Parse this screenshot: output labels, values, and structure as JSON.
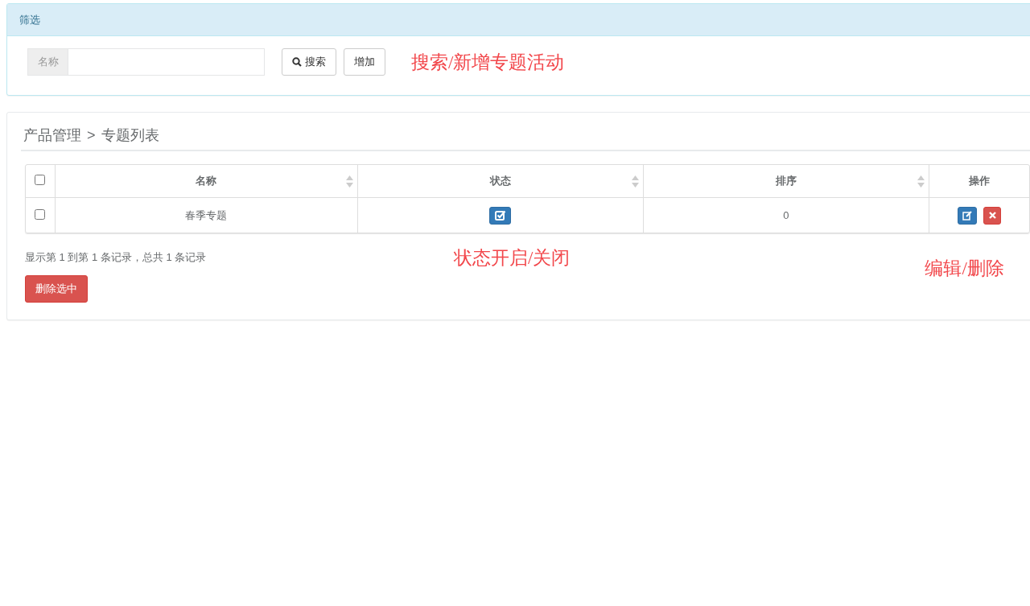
{
  "filter_panel": {
    "title": "筛选",
    "name_field": {
      "label": "名称"
    },
    "buttons": [
      {
        "kind": "search",
        "label": "搜索"
      },
      {
        "kind": "plain",
        "label": "增加"
      }
    ],
    "annotation": "搜索/新增专题活动"
  },
  "list_panel": {
    "breadcrumb": [
      "产品管理",
      ">",
      "专题列表"
    ],
    "table": {
      "select_all": {
        "checked": false
      },
      "columns": [
        {
          "label": "名称",
          "sortable": true
        },
        {
          "label": "状态",
          "sortable": true
        },
        {
          "label": "排序",
          "sortable": true
        },
        {
          "label": "操作",
          "sortable": false
        }
      ],
      "rows": [
        {
          "checked": false,
          "name": "春季专题",
          "status_on": true,
          "sort": "0"
        }
      ]
    },
    "summary": "显示第 1 到第 1 条记录，总共 1 条记录",
    "status_annotation": "状态开启/关闭",
    "actions_annotation": "编辑/删除",
    "delete_selected": "删除选中"
  }
}
